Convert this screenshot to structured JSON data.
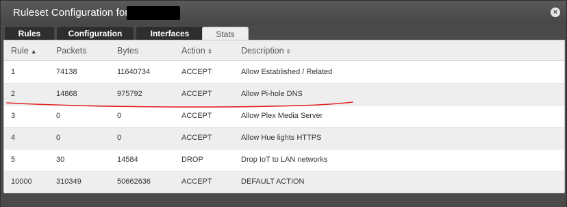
{
  "window": {
    "title": "Ruleset Configuration for",
    "close_glyph": "×"
  },
  "tabs": [
    {
      "label": "Rules",
      "active": false
    },
    {
      "label": "Configuration",
      "active": false
    },
    {
      "label": "Interfaces",
      "active": false
    },
    {
      "label": "Stats",
      "active": true
    }
  ],
  "table": {
    "columns": [
      {
        "label": "Rule",
        "sort": "▲"
      },
      {
        "label": "Packets",
        "sort": ""
      },
      {
        "label": "Bytes",
        "sort": ""
      },
      {
        "label": "Action",
        "sort": "⇳"
      },
      {
        "label": "Description",
        "sort": "⇳"
      }
    ],
    "rows": [
      {
        "rule": "1",
        "packets": "74138",
        "bytes": "11640734",
        "action": "ACCEPT",
        "description": "Allow Established / Related"
      },
      {
        "rule": "2",
        "packets": "14868",
        "bytes": "975792",
        "action": "ACCEPT",
        "description": "Allow Pi-hole DNS"
      },
      {
        "rule": "3",
        "packets": "0",
        "bytes": "0",
        "action": "ACCEPT",
        "description": "Allow Plex Media Server"
      },
      {
        "rule": "4",
        "packets": "0",
        "bytes": "0",
        "action": "ACCEPT",
        "description": "Allow Hue lights HTTPS"
      },
      {
        "rule": "5",
        "packets": "30",
        "bytes": "14584",
        "action": "DROP",
        "description": "Drop IoT to LAN networks"
      },
      {
        "rule": "10000",
        "packets": "310349",
        "bytes": "50662636",
        "action": "ACCEPT",
        "description": "DEFAULT ACTION"
      }
    ]
  },
  "colors": {
    "dialog_bg": "#4a4a4a",
    "annotation_line": "#e02020"
  }
}
